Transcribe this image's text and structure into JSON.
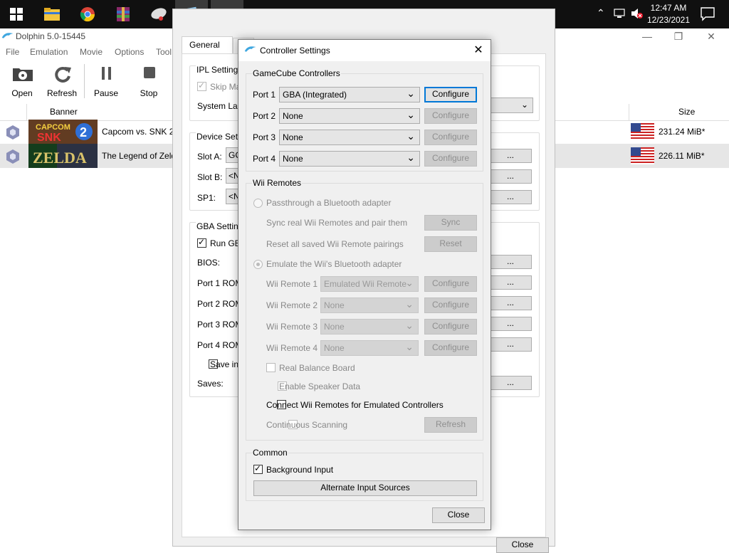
{
  "taskbar": {
    "time": "12:47 AM",
    "date": "12/23/2021"
  },
  "main": {
    "title": "Dolphin 5.0-15445",
    "menu": [
      "File",
      "Emulation",
      "Movie",
      "Options",
      "Tool"
    ],
    "toolbar": [
      "Open",
      "Refresh",
      "Pause",
      "Stop"
    ],
    "columns": {
      "banner": "Banner",
      "size": "Size"
    },
    "games": [
      {
        "title": "Capcom vs. SNK 2",
        "size": "231.24 MiB*"
      },
      {
        "title": "The Legend of Zeld",
        "size": "226.11 MiB*"
      }
    ]
  },
  "config": {
    "tabs": [
      "General",
      "I"
    ],
    "ipl": {
      "title": "IPL Settings",
      "skip": "Skip Ma",
      "lang": "System Lan"
    },
    "device": {
      "title": "Device Setti",
      "slot_a": "Slot A:",
      "slot_a_val": "GC",
      "slot_b": "Slot B:",
      "slot_b_val": "<N",
      "sp1": "SP1:",
      "sp1_val": "<N"
    },
    "gba": {
      "title": "GBA Setting",
      "run": "Run GBA",
      "bios": "BIOS:",
      "port1": "Port 1 ROM",
      "port2": "Port 2 ROM",
      "port3": "Port 3 ROM",
      "port4": "Port 4 ROM",
      "save_in": "Save in S",
      "saves": "Saves:"
    },
    "dots": "...",
    "close": "Close"
  },
  "dialog": {
    "title": "Controller Settings",
    "gc_group": "GameCube Controllers",
    "ports": [
      {
        "label": "Port 1",
        "value": "GBA (Integrated)",
        "button": "Configure"
      },
      {
        "label": "Port 2",
        "value": "None",
        "button": "Configure"
      },
      {
        "label": "Port 3",
        "value": "None",
        "button": "Configure"
      },
      {
        "label": "Port 4",
        "value": "None",
        "button": "Configure"
      }
    ],
    "wii_group": "Wii Remotes",
    "passthrough": "Passthrough a Bluetooth adapter",
    "sync_text": "Sync real Wii Remotes and pair them",
    "sync_btn": "Sync",
    "reset_text": "Reset all saved Wii Remote pairings",
    "reset_btn": "Reset",
    "emulate": "Emulate the Wii's Bluetooth adapter",
    "remotes": [
      {
        "label": "Wii Remote 1",
        "value": "Emulated Wii Remote",
        "button": "Configure"
      },
      {
        "label": "Wii Remote 2",
        "value": "None",
        "button": "Configure"
      },
      {
        "label": "Wii Remote 3",
        "value": "None",
        "button": "Configure"
      },
      {
        "label": "Wii Remote 4",
        "value": "None",
        "button": "Configure"
      }
    ],
    "balance": "Real Balance Board",
    "speaker": "Enable Speaker Data",
    "connect": "Connect Wii Remotes for Emulated Controllers",
    "continuous": "Continuous Scanning",
    "refresh": "Refresh",
    "common_group": "Common",
    "background": "Background Input",
    "alternate": "Alternate Input Sources",
    "close": "Close"
  }
}
